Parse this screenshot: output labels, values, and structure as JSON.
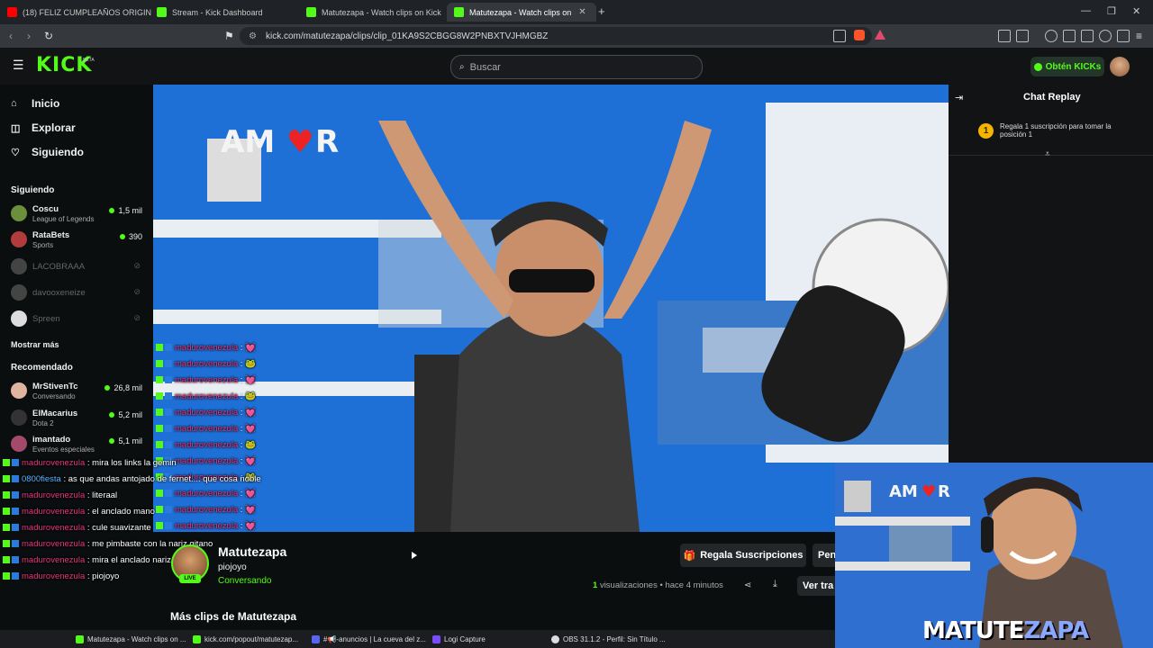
{
  "browser": {
    "tabs": [
      {
        "title": "(18) FELIZ CUMPLEAÑOS ORIGINAL",
        "color": "#ff0000"
      },
      {
        "title": "Stream - Kick Dashboard",
        "color": "#53fc18"
      },
      {
        "title": "Matutezapa - Watch clips on Kick",
        "color": "#53fc18"
      },
      {
        "title": "Matutezapa - Watch clips on",
        "color": "#53fc18"
      }
    ],
    "url": "kick.com/matutezapa/clips/clip_01KA9S2CBGG8W2PNBXTVJHMGBZ",
    "new_tab": "+"
  },
  "kick": {
    "logo": "KICK",
    "beta": "BETA",
    "search_placeholder": "Buscar",
    "get_kicks": "Obtén KICKs",
    "accent": "#53fc18"
  },
  "sidebar": {
    "nav": [
      {
        "label": "Inicio",
        "icon": "home-icon"
      },
      {
        "label": "Explorar",
        "icon": "compass-icon"
      },
      {
        "label": "Siguiendo",
        "icon": "heart-icon"
      }
    ],
    "following_title": "Siguiendo",
    "following": [
      {
        "name": "Coscu",
        "category": "League of Legends",
        "viewers": "1,5 mil"
      },
      {
        "name": "RataBets",
        "category": "Sports",
        "viewers": "390"
      },
      {
        "name": "LACOBRAAA",
        "category": "",
        "viewers": ""
      },
      {
        "name": "davooxeneize",
        "category": "",
        "viewers": ""
      },
      {
        "name": "Spreen",
        "category": "",
        "viewers": ""
      }
    ],
    "show_more": "Mostrar más",
    "recommended_title": "Recomendado",
    "recommended": [
      {
        "name": "MrStivenTc",
        "category": "Conversando",
        "viewers": "26,8 mil"
      },
      {
        "name": "ElMacarius",
        "category": "Dota 2",
        "viewers": "5,2 mil"
      },
      {
        "name": "imantado",
        "category": "Eventos especiales",
        "viewers": "5,1 mil"
      }
    ]
  },
  "overlay_chat": [
    {
      "user": "madurovenezula",
      "msg": ": 💓"
    },
    {
      "user": "madurovenezula",
      "msg": ": 🐸"
    },
    {
      "user": "madurovenezula",
      "msg": ": 💓"
    },
    {
      "user": "madurovenezula",
      "msg": ": 🐸"
    },
    {
      "user": "madurovenezula",
      "msg": ": 💓"
    },
    {
      "user": "madurovenezula",
      "msg": ": 💓"
    },
    {
      "user": "madurovenezula",
      "msg": ": 🐸"
    },
    {
      "user": "madurovenezula",
      "msg": ": 💓"
    },
    {
      "user": "madurovenezula",
      "msg": ": 🐸"
    },
    {
      "user": "madurovenezula",
      "msg": ": 💓"
    },
    {
      "user": "madurovenezula",
      "msg": ": 💓"
    },
    {
      "user": "madurovenezula",
      "msg": ": 💓"
    }
  ],
  "overlay_chat2": [
    {
      "user": "madurovenezula",
      "msg": ": mira los links la gemin"
    },
    {
      "user": "0800fiesta",
      "msg": ": as que andas antojado de fernet.... que cosa noble"
    },
    {
      "user": "madurovenezula",
      "msg": ": literaal"
    },
    {
      "user": "madurovenezula",
      "msg": ": el anclado mano"
    },
    {
      "user": "madurovenezula",
      "msg": ": cule suavizante"
    },
    {
      "user": "madurovenezula",
      "msg": ": me pimbaste con la nariz gitano"
    },
    {
      "user": "madurovenezula",
      "msg": ": mira el anclado nariz"
    },
    {
      "user": "madurovenezula",
      "msg": ": piojoyo"
    }
  ],
  "chat": {
    "title": "Chat Replay",
    "pin_rank": "1",
    "pin_text": "Regala 1 suscripción para tomar la posición 1"
  },
  "clip": {
    "channel": "Matutezapa",
    "title": "piojoyo",
    "category": "Conversando",
    "live": "LIVE",
    "gift_subs": "Regala Suscripciones",
    "pen_btn": "Pen",
    "views": "1",
    "views_label": "visualizaciones",
    "time": "• hace 4 minutos",
    "ver_btn": "Ver tra",
    "more_clips": "Más clips de Matutezapa"
  },
  "taskbar": [
    {
      "label": "Matutezapa - Watch clips on ...",
      "color": "#53fc18"
    },
    {
      "label": "kick.com/popout/matutezap...",
      "color": "#53fc18"
    },
    {
      "label": "#📢-anuncios | La cueva del z...",
      "color": "#5865f2"
    },
    {
      "label": "Logi Capture",
      "color": "#7b4cff"
    },
    {
      "label": "OBS 31.1.2 - Perfil: Sin Título ...",
      "color": "#dddddd"
    }
  ],
  "webcam": {
    "brand_a": "MATUTE",
    "brand_b": "ZAPA"
  }
}
